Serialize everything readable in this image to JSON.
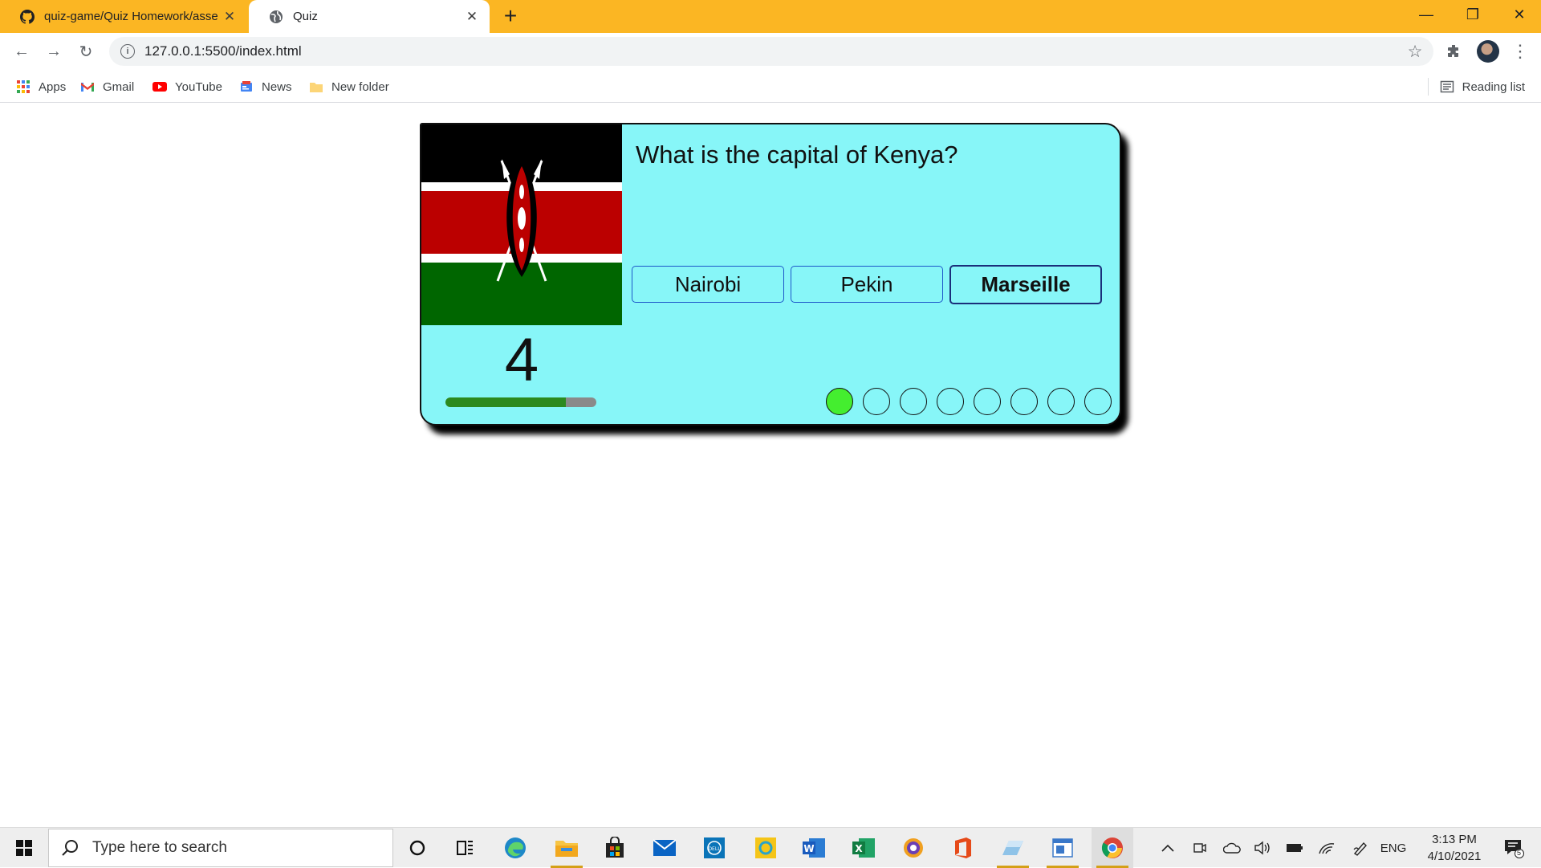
{
  "browser": {
    "tabs": [
      {
        "title": "quiz-game/Quiz Homework/asse",
        "icon": "github-icon"
      },
      {
        "title": "Quiz",
        "icon": "globe-icon",
        "active": true
      }
    ],
    "new_tab_label": "+",
    "url": "127.0.0.1:5500/index.html",
    "bookmarks": [
      {
        "label": "Apps",
        "icon": "apps-grid-icon"
      },
      {
        "label": "Gmail",
        "icon": "gmail-icon"
      },
      {
        "label": "YouTube",
        "icon": "youtube-icon"
      },
      {
        "label": "News",
        "icon": "news-icon"
      },
      {
        "label": "New folder",
        "icon": "folder-icon"
      }
    ],
    "reading_list_label": "Reading list",
    "accent_color": "#fbb623"
  },
  "quiz": {
    "question": "What is the capital of Kenya?",
    "answers": [
      {
        "label": "Nairobi",
        "selected": false
      },
      {
        "label": "Pekin",
        "selected": false
      },
      {
        "label": "Marseille",
        "selected": true
      }
    ],
    "timer_value": "4",
    "timer_progress_fraction": 0.8,
    "progress_dots": [
      true,
      false,
      false,
      false,
      false,
      false,
      false,
      false
    ],
    "flag": "kenya-flag",
    "colors": {
      "card_bg": "#87f6f8",
      "dot_done": "#44ee2f",
      "timer_fill": "#2c8a1f"
    }
  },
  "taskbar": {
    "search_placeholder": "Type here to search",
    "language": "ENG",
    "time": "3:13 PM",
    "date": "4/10/2021",
    "notification_count": "5"
  }
}
